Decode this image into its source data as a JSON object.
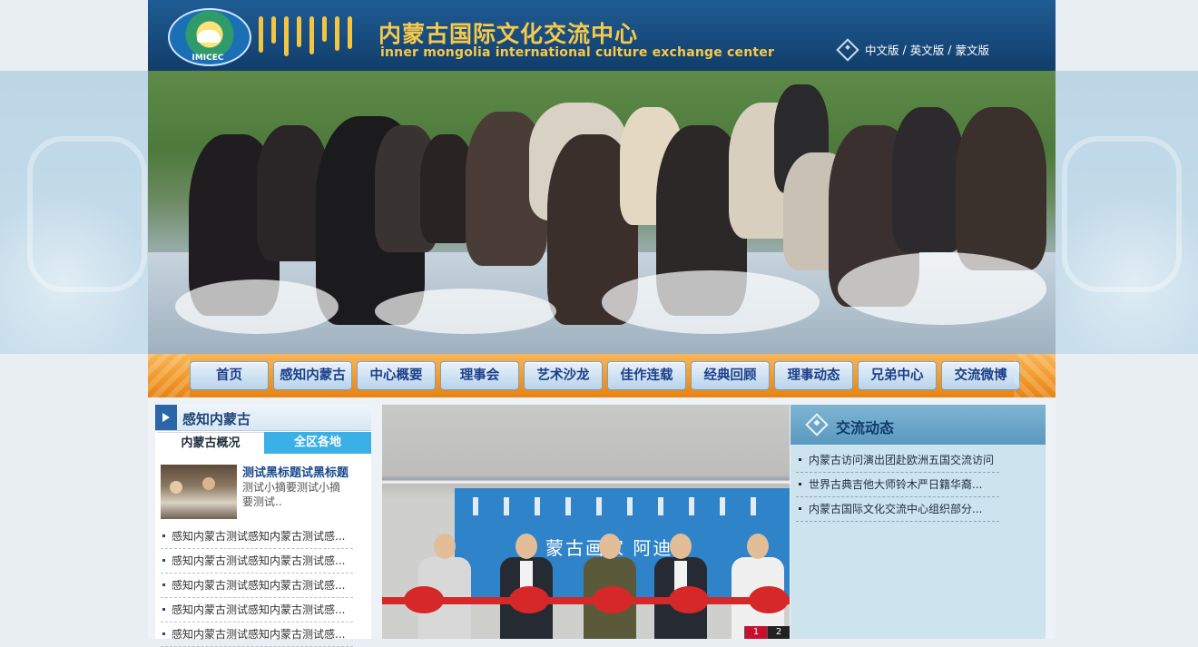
{
  "header": {
    "title_cn": "内蒙古国际文化交流中心",
    "title_en": "inner mongolia international culture exchange center",
    "logo_text": "IMICEC",
    "languages": [
      "中文版",
      "英文版",
      "蒙文版"
    ]
  },
  "nav": {
    "items": [
      "首页",
      "感知内蒙古",
      "中心概要",
      "理事会",
      "艺术沙龙",
      "佳作连载",
      "经典回顾",
      "理事动态",
      "兄弟中心",
      "交流微博"
    ]
  },
  "left": {
    "section_title": "感知内蒙古",
    "tabs": [
      "内蒙古概况",
      "全区各地"
    ],
    "active_tab": 0,
    "feature": {
      "title": "测试黑标题试黑标题",
      "summary": "测试小摘要测试小摘要测试.."
    },
    "list": [
      "感知内蒙古测试感知内蒙古测试感...",
      "感知内蒙古测试感知内蒙古测试感...",
      "感知内蒙古测试感知内蒙古测试感...",
      "感知内蒙古测试感知内蒙古测试感...",
      "感知内蒙古测试感知内蒙古测试感..."
    ]
  },
  "center": {
    "photo_caption": "蒙古画家 阿迪",
    "slides": [
      "1",
      "2"
    ],
    "active_slide": 0
  },
  "right": {
    "section_title": "交流动态",
    "list": [
      "内蒙古访问演出团赴欧洲五国交流访问",
      "世界古典吉他大师铃木严日籍华裔...",
      "内蒙古国际文化交流中心组织部分..."
    ]
  },
  "colors": {
    "header_blue": "#174a7c",
    "title_gold": "#f7c948",
    "nav_orange": "#f19a2a",
    "tab_active_blue": "#3ab0e6",
    "right_panel": "#cde3ee"
  }
}
